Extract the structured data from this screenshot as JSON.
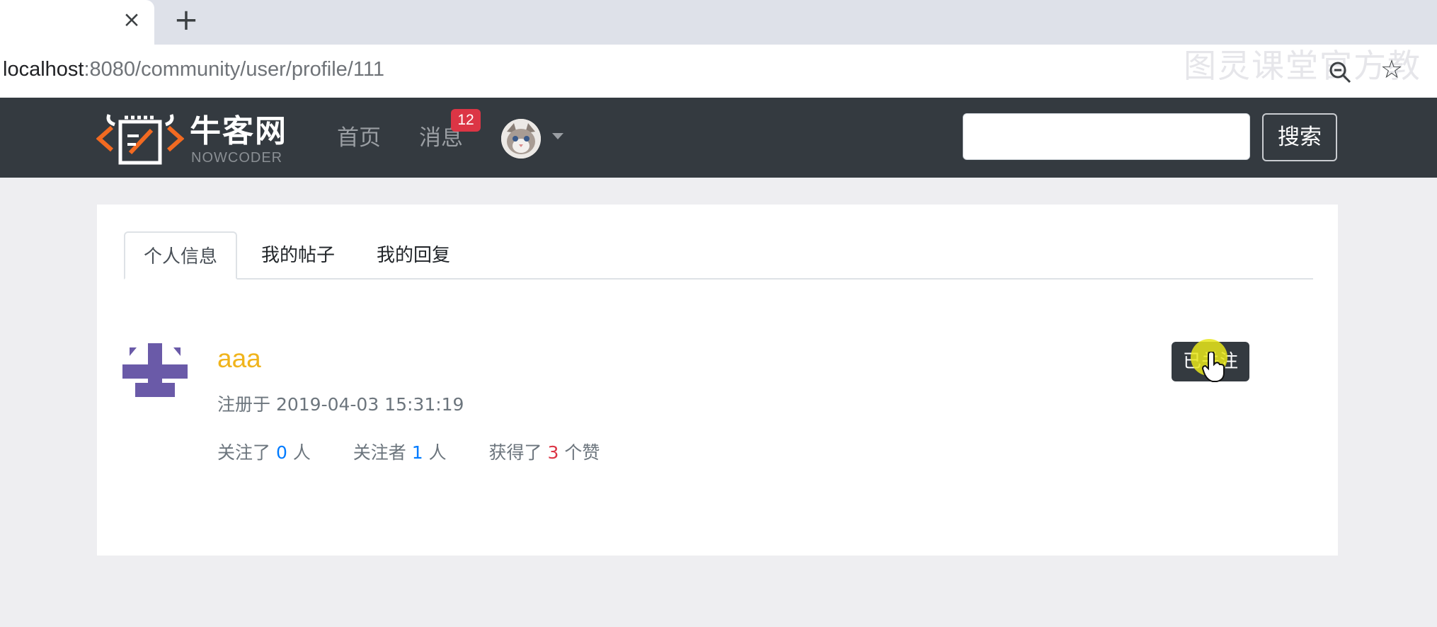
{
  "browser": {
    "tab_close_symbol": "×",
    "new_tab_symbol": "+",
    "url_host": "localhost",
    "url_path": ":8080/community/user/profile/111",
    "watermark": "图灵课堂官方教",
    "star_symbol": "☆"
  },
  "navbar": {
    "logo_text": "牛客网",
    "logo_sub": "NOWCODER",
    "links": [
      "首页",
      "消息"
    ],
    "message_badge": "12",
    "search_button": "搜索",
    "search_placeholder": ""
  },
  "profile": {
    "tabs": [
      "个人信息",
      "我的帖子",
      "我的回复"
    ],
    "active_tab": "个人信息",
    "username": "aaa",
    "registered": "注册于 2019-04-03 15:31:19",
    "stats": {
      "following_prefix": "关注了",
      "following_count": "0",
      "following_suffix": "人",
      "followers_prefix": "关注者",
      "followers_count": "1",
      "followers_suffix": "人",
      "likes_prefix": "获得了",
      "likes_count": "3",
      "likes_suffix": "个赞"
    },
    "follow_button": "已关注"
  },
  "colors": {
    "navbar_bg": "#343a40",
    "username": "#f0b41c",
    "badge": "#dc3545",
    "count_blue": "#007bff",
    "count_red": "#dc3545"
  }
}
